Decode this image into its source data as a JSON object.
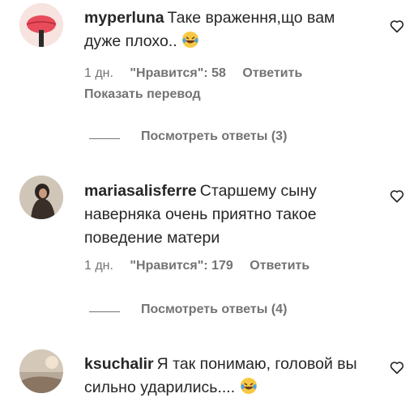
{
  "comments": [
    {
      "username": "myperluna",
      "text": "Таке враження,що вам дуже плохо..",
      "emoji": "laughing-tears-emoji",
      "time": "1 дн.",
      "likes": "\"Нравится\": 58",
      "reply": "Ответить",
      "translate": "Показать перевод",
      "view_replies": "Посмотреть ответы (3)"
    },
    {
      "username": "mariasalisferre",
      "text": "Старшему сыну наверняка очень приятно такое поведение матери",
      "time": "1 дн.",
      "likes": "\"Нравится\": 179",
      "reply": "Ответить",
      "view_replies": "Посмотреть ответы (4)"
    },
    {
      "username": "ksuchalir",
      "text": "Я так понимаю, головой вы сильно ударились....",
      "emoji": "laughing-tears-emoji"
    }
  ],
  "icons": {
    "like": "heart-outline-icon"
  },
  "colors": {
    "text": "#262626",
    "secondary": "#737373"
  }
}
